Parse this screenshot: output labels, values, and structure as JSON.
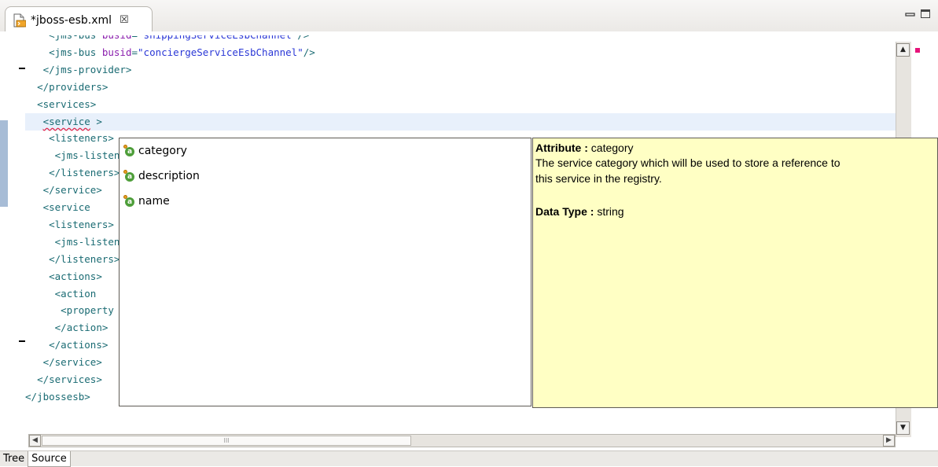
{
  "tab": {
    "title": "*jboss-esb.xml",
    "close_glyph": "☒",
    "icon": "xml-file-icon"
  },
  "window_controls": {
    "minimize": "minimize-icon",
    "maximize": "maximize-icon"
  },
  "code_lines": [
    {
      "indent": "    ",
      "parts": [
        [
          "tag",
          "<jms-bus "
        ],
        [
          "attr",
          "busid"
        ],
        [
          "tag",
          "="
        ],
        [
          "val",
          "\"shippingServiceEsbChannel\""
        ],
        [
          "tag",
          "/>"
        ]
      ]
    },
    {
      "indent": "    ",
      "parts": [
        [
          "tag",
          "<jms-bus "
        ],
        [
          "attr",
          "busid"
        ],
        [
          "tag",
          "="
        ],
        [
          "val",
          "\"conciergeServiceEsbChannel\""
        ],
        [
          "tag",
          "/>"
        ]
      ]
    },
    {
      "indent": "   ",
      "parts": [
        [
          "tag",
          "</jms-provider>"
        ]
      ]
    },
    {
      "indent": "  ",
      "parts": [
        [
          "tag",
          "</providers>"
        ]
      ]
    },
    {
      "indent": "  ",
      "parts": [
        [
          "tag",
          "<services>"
        ]
      ]
    },
    {
      "indent": "   ",
      "parts": [
        [
          "squig",
          "<service"
        ],
        [
          "tag",
          " >"
        ]
      ],
      "highlight": true
    },
    {
      "indent": "    ",
      "parts": [
        [
          "tag",
          "<listeners>"
        ]
      ]
    },
    {
      "indent": "     ",
      "parts": [
        [
          "tag",
          "<jms-listener"
        ]
      ]
    },
    {
      "indent": "    ",
      "parts": [
        [
          "tag",
          "</listeners>"
        ]
      ]
    },
    {
      "indent": "   ",
      "parts": [
        [
          "tag",
          "</service>"
        ]
      ]
    },
    {
      "indent": "   ",
      "parts": [
        [
          "tag",
          "<service"
        ]
      ]
    },
    {
      "indent": "    ",
      "parts": [
        [
          "tag",
          "<listeners>"
        ]
      ]
    },
    {
      "indent": "     ",
      "parts": [
        [
          "tag",
          "<jms-listener"
        ]
      ]
    },
    {
      "indent": "    ",
      "parts": [
        [
          "tag",
          "</listeners>"
        ]
      ]
    },
    {
      "indent": "    ",
      "parts": [
        [
          "tag",
          "<actions>"
        ]
      ]
    },
    {
      "indent": "     ",
      "parts": [
        [
          "tag",
          "<action"
        ]
      ]
    },
    {
      "indent": "      ",
      "parts": [
        [
          "tag",
          "<property"
        ]
      ]
    },
    {
      "indent": "     ",
      "parts": [
        [
          "tag",
          "</action>"
        ]
      ]
    },
    {
      "indent": "    ",
      "parts": [
        [
          "tag",
          "</actions>"
        ]
      ]
    },
    {
      "indent": "   ",
      "parts": [
        [
          "tag",
          "</service>"
        ]
      ]
    },
    {
      "indent": "  ",
      "parts": [
        [
          "tag",
          "</services>"
        ]
      ]
    },
    {
      "indent": "",
      "parts": [
        [
          "tag",
          "</jbossesb>"
        ]
      ]
    }
  ],
  "content_assist": {
    "items": [
      {
        "label": "category",
        "selected": true,
        "icon": "attribute-icon"
      },
      {
        "label": "description",
        "selected": false,
        "icon": "attribute-icon"
      },
      {
        "label": "name",
        "selected": false,
        "icon": "attribute-icon"
      }
    ]
  },
  "info": {
    "attribute_label": "Attribute :",
    "attribute_value": "category",
    "description_line1": "The service category which will be used to store a reference to",
    "description_line2": " this service in the registry.",
    "data_type_label": "Data Type :",
    "data_type_value": "string"
  },
  "bottom_tabs": [
    {
      "label": "Tree",
      "active": false
    },
    {
      "label": "Source",
      "active": true
    }
  ],
  "colors": {
    "tag": "#1a6b73",
    "attribute": "#8b1fae",
    "value": "#2a37d6",
    "info_bg": "#ffffc4",
    "selection": "#74716c"
  }
}
